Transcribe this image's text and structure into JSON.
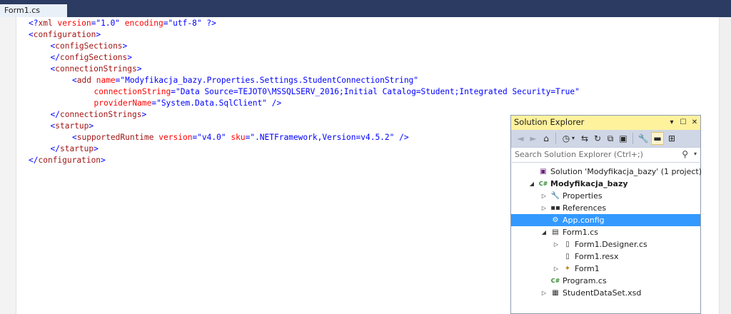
{
  "tab": {
    "label": "Form1.cs"
  },
  "code_lines": [
    {
      "indent": 0,
      "tokens": [
        {
          "t": "br",
          "v": "<?"
        },
        {
          "t": "el",
          "v": "xml"
        },
        {
          "t": "sp",
          "v": " "
        },
        {
          "t": "at",
          "v": "version"
        },
        {
          "t": "eq",
          "v": "="
        },
        {
          "t": "q",
          "v": "\"1.0\""
        },
        {
          "t": "sp",
          "v": " "
        },
        {
          "t": "at",
          "v": "encoding"
        },
        {
          "t": "eq",
          "v": "="
        },
        {
          "t": "q",
          "v": "\"utf-8\""
        },
        {
          "t": "sp",
          "v": " "
        },
        {
          "t": "br",
          "v": "?>"
        }
      ]
    },
    {
      "indent": 0,
      "tokens": [
        {
          "t": "br",
          "v": "<"
        },
        {
          "t": "el",
          "v": "configuration"
        },
        {
          "t": "br",
          "v": ">"
        }
      ]
    },
    {
      "indent": 1,
      "tokens": [
        {
          "t": "br",
          "v": "<"
        },
        {
          "t": "el",
          "v": "configSections"
        },
        {
          "t": "br",
          "v": ">"
        }
      ]
    },
    {
      "indent": 1,
      "tokens": [
        {
          "t": "br",
          "v": "</"
        },
        {
          "t": "el",
          "v": "configSections"
        },
        {
          "t": "br",
          "v": ">"
        }
      ]
    },
    {
      "indent": 1,
      "tokens": [
        {
          "t": "br",
          "v": "<"
        },
        {
          "t": "el",
          "v": "connectionStrings"
        },
        {
          "t": "br",
          "v": ">"
        }
      ]
    },
    {
      "indent": 2,
      "tokens": [
        {
          "t": "br",
          "v": "<"
        },
        {
          "t": "el",
          "v": "add"
        },
        {
          "t": "sp",
          "v": " "
        },
        {
          "t": "at",
          "v": "name"
        },
        {
          "t": "eq",
          "v": "="
        },
        {
          "t": "q",
          "v": "\"Modyfikacja_bazy.Properties.Settings.StudentConnectionString\""
        }
      ]
    },
    {
      "indent": 3,
      "tokens": [
        {
          "t": "at",
          "v": "connectionString"
        },
        {
          "t": "eq",
          "v": "="
        },
        {
          "t": "q",
          "v": "\"Data Source=TEJOT0\\MSSQLSERV_2016;Initial Catalog=Student;Integrated Security=True\""
        }
      ]
    },
    {
      "indent": 3,
      "tokens": [
        {
          "t": "at",
          "v": "providerName"
        },
        {
          "t": "eq",
          "v": "="
        },
        {
          "t": "q",
          "v": "\"System.Data.SqlClient\""
        },
        {
          "t": "sp",
          "v": " "
        },
        {
          "t": "br",
          "v": "/>"
        }
      ]
    },
    {
      "indent": 1,
      "tokens": [
        {
          "t": "br",
          "v": "</"
        },
        {
          "t": "el",
          "v": "connectionStrings"
        },
        {
          "t": "br",
          "v": ">"
        }
      ]
    },
    {
      "indent": 1,
      "tokens": [
        {
          "t": "br",
          "v": "<"
        },
        {
          "t": "el",
          "v": "startup"
        },
        {
          "t": "br",
          "v": ">"
        }
      ]
    },
    {
      "indent": 2,
      "tokens": [
        {
          "t": "br",
          "v": "<"
        },
        {
          "t": "el",
          "v": "supportedRuntime"
        },
        {
          "t": "sp",
          "v": " "
        },
        {
          "t": "at",
          "v": "version"
        },
        {
          "t": "eq",
          "v": "="
        },
        {
          "t": "q",
          "v": "\"v4.0\""
        },
        {
          "t": "sp",
          "v": " "
        },
        {
          "t": "at",
          "v": "sku"
        },
        {
          "t": "eq",
          "v": "="
        },
        {
          "t": "q",
          "v": "\".NETFramework,Version=v4.5.2\""
        },
        {
          "t": "sp",
          "v": " "
        },
        {
          "t": "br",
          "v": "/>"
        }
      ]
    },
    {
      "indent": 1,
      "tokens": [
        {
          "t": "br",
          "v": "</"
        },
        {
          "t": "el",
          "v": "startup"
        },
        {
          "t": "br",
          "v": ">"
        }
      ]
    },
    {
      "indent": 0,
      "tokens": [
        {
          "t": "br",
          "v": "</"
        },
        {
          "t": "el",
          "v": "configuration"
        },
        {
          "t": "br",
          "v": ">"
        }
      ]
    }
  ],
  "solution_explorer": {
    "title": "Solution Explorer",
    "title_buttons": {
      "dropdown": "▾",
      "pin": "☐",
      "close": "✕"
    },
    "search": {
      "placeholder": "Search Solution Explorer (Ctrl+;)"
    },
    "tree": [
      {
        "level": 0,
        "expander": "",
        "icon": "solution-icon",
        "glyph": "▣",
        "color": "#68217a",
        "label": "Solution 'Modyfikacja_bazy' (1 project)",
        "bold": false,
        "selected": false
      },
      {
        "level": 0,
        "expander": "◢",
        "icon": "csharp-project-icon",
        "glyph": "C#",
        "color": "#368832",
        "label": "Modyfikacja_bazy",
        "bold": true,
        "selected": false
      },
      {
        "level": 1,
        "expander": "▷",
        "icon": "wrench-icon",
        "glyph": "🔧",
        "color": "#333333",
        "label": "Properties",
        "bold": false,
        "selected": false
      },
      {
        "level": 1,
        "expander": "▷",
        "icon": "references-icon",
        "glyph": "▪▪",
        "color": "#333333",
        "label": "References",
        "bold": false,
        "selected": false
      },
      {
        "level": 1,
        "expander": "",
        "icon": "config-file-icon",
        "glyph": "⚙",
        "color": "#333333",
        "label": "App.config",
        "bold": false,
        "selected": true
      },
      {
        "level": 1,
        "expander": "◢",
        "icon": "form-icon",
        "glyph": "▤",
        "color": "#333333",
        "label": "Form1.cs",
        "bold": false,
        "selected": false
      },
      {
        "level": 2,
        "expander": "▷",
        "icon": "cs-file-icon",
        "glyph": "▯",
        "color": "#333333",
        "label": "Form1.Designer.cs",
        "bold": false,
        "selected": false
      },
      {
        "level": 2,
        "expander": "",
        "icon": "resx-file-icon",
        "glyph": "▯",
        "color": "#333333",
        "label": "Form1.resx",
        "bold": false,
        "selected": false
      },
      {
        "level": 2,
        "expander": "▷",
        "icon": "class-icon",
        "glyph": "✦",
        "color": "#c2841b",
        "label": "Form1",
        "bold": false,
        "selected": false
      },
      {
        "level": 1,
        "expander": "",
        "icon": "csharp-file-icon",
        "glyph": "C#",
        "color": "#368832",
        "label": "Program.cs",
        "bold": false,
        "selected": false
      },
      {
        "level": 1,
        "expander": "▷",
        "icon": "dataset-icon",
        "glyph": "▦",
        "color": "#333333",
        "label": "StudentDataSet.xsd",
        "bold": false,
        "selected": false
      }
    ]
  },
  "colors": {
    "tab_strip": "#2b3b61",
    "se_title": "#fff29d",
    "selection": "#3399ff"
  }
}
